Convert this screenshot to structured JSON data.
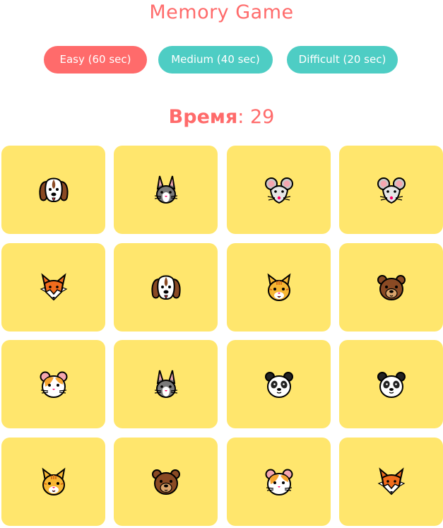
{
  "title": "Memory Game",
  "levels": [
    {
      "label": "Easy (60 sec)",
      "active": true
    },
    {
      "label": "Medium (40 sec)",
      "active": false
    },
    {
      "label": "Difficult (20 sec)",
      "active": false
    }
  ],
  "timer": {
    "label": "Время",
    "value": "29"
  },
  "colors": {
    "accent": "#ff6b6b",
    "button": "#4ecdc4",
    "card": "#ffe66d"
  },
  "cards": [
    {
      "icon": "dog"
    },
    {
      "icon": "rabbit"
    },
    {
      "icon": "mouse"
    },
    {
      "icon": "mouse"
    },
    {
      "icon": "fox"
    },
    {
      "icon": "dog"
    },
    {
      "icon": "cat"
    },
    {
      "icon": "bear"
    },
    {
      "icon": "hamster"
    },
    {
      "icon": "rabbit"
    },
    {
      "icon": "panda"
    },
    {
      "icon": "panda"
    },
    {
      "icon": "cat"
    },
    {
      "icon": "bear"
    },
    {
      "icon": "hamster"
    },
    {
      "icon": "fox"
    }
  ]
}
